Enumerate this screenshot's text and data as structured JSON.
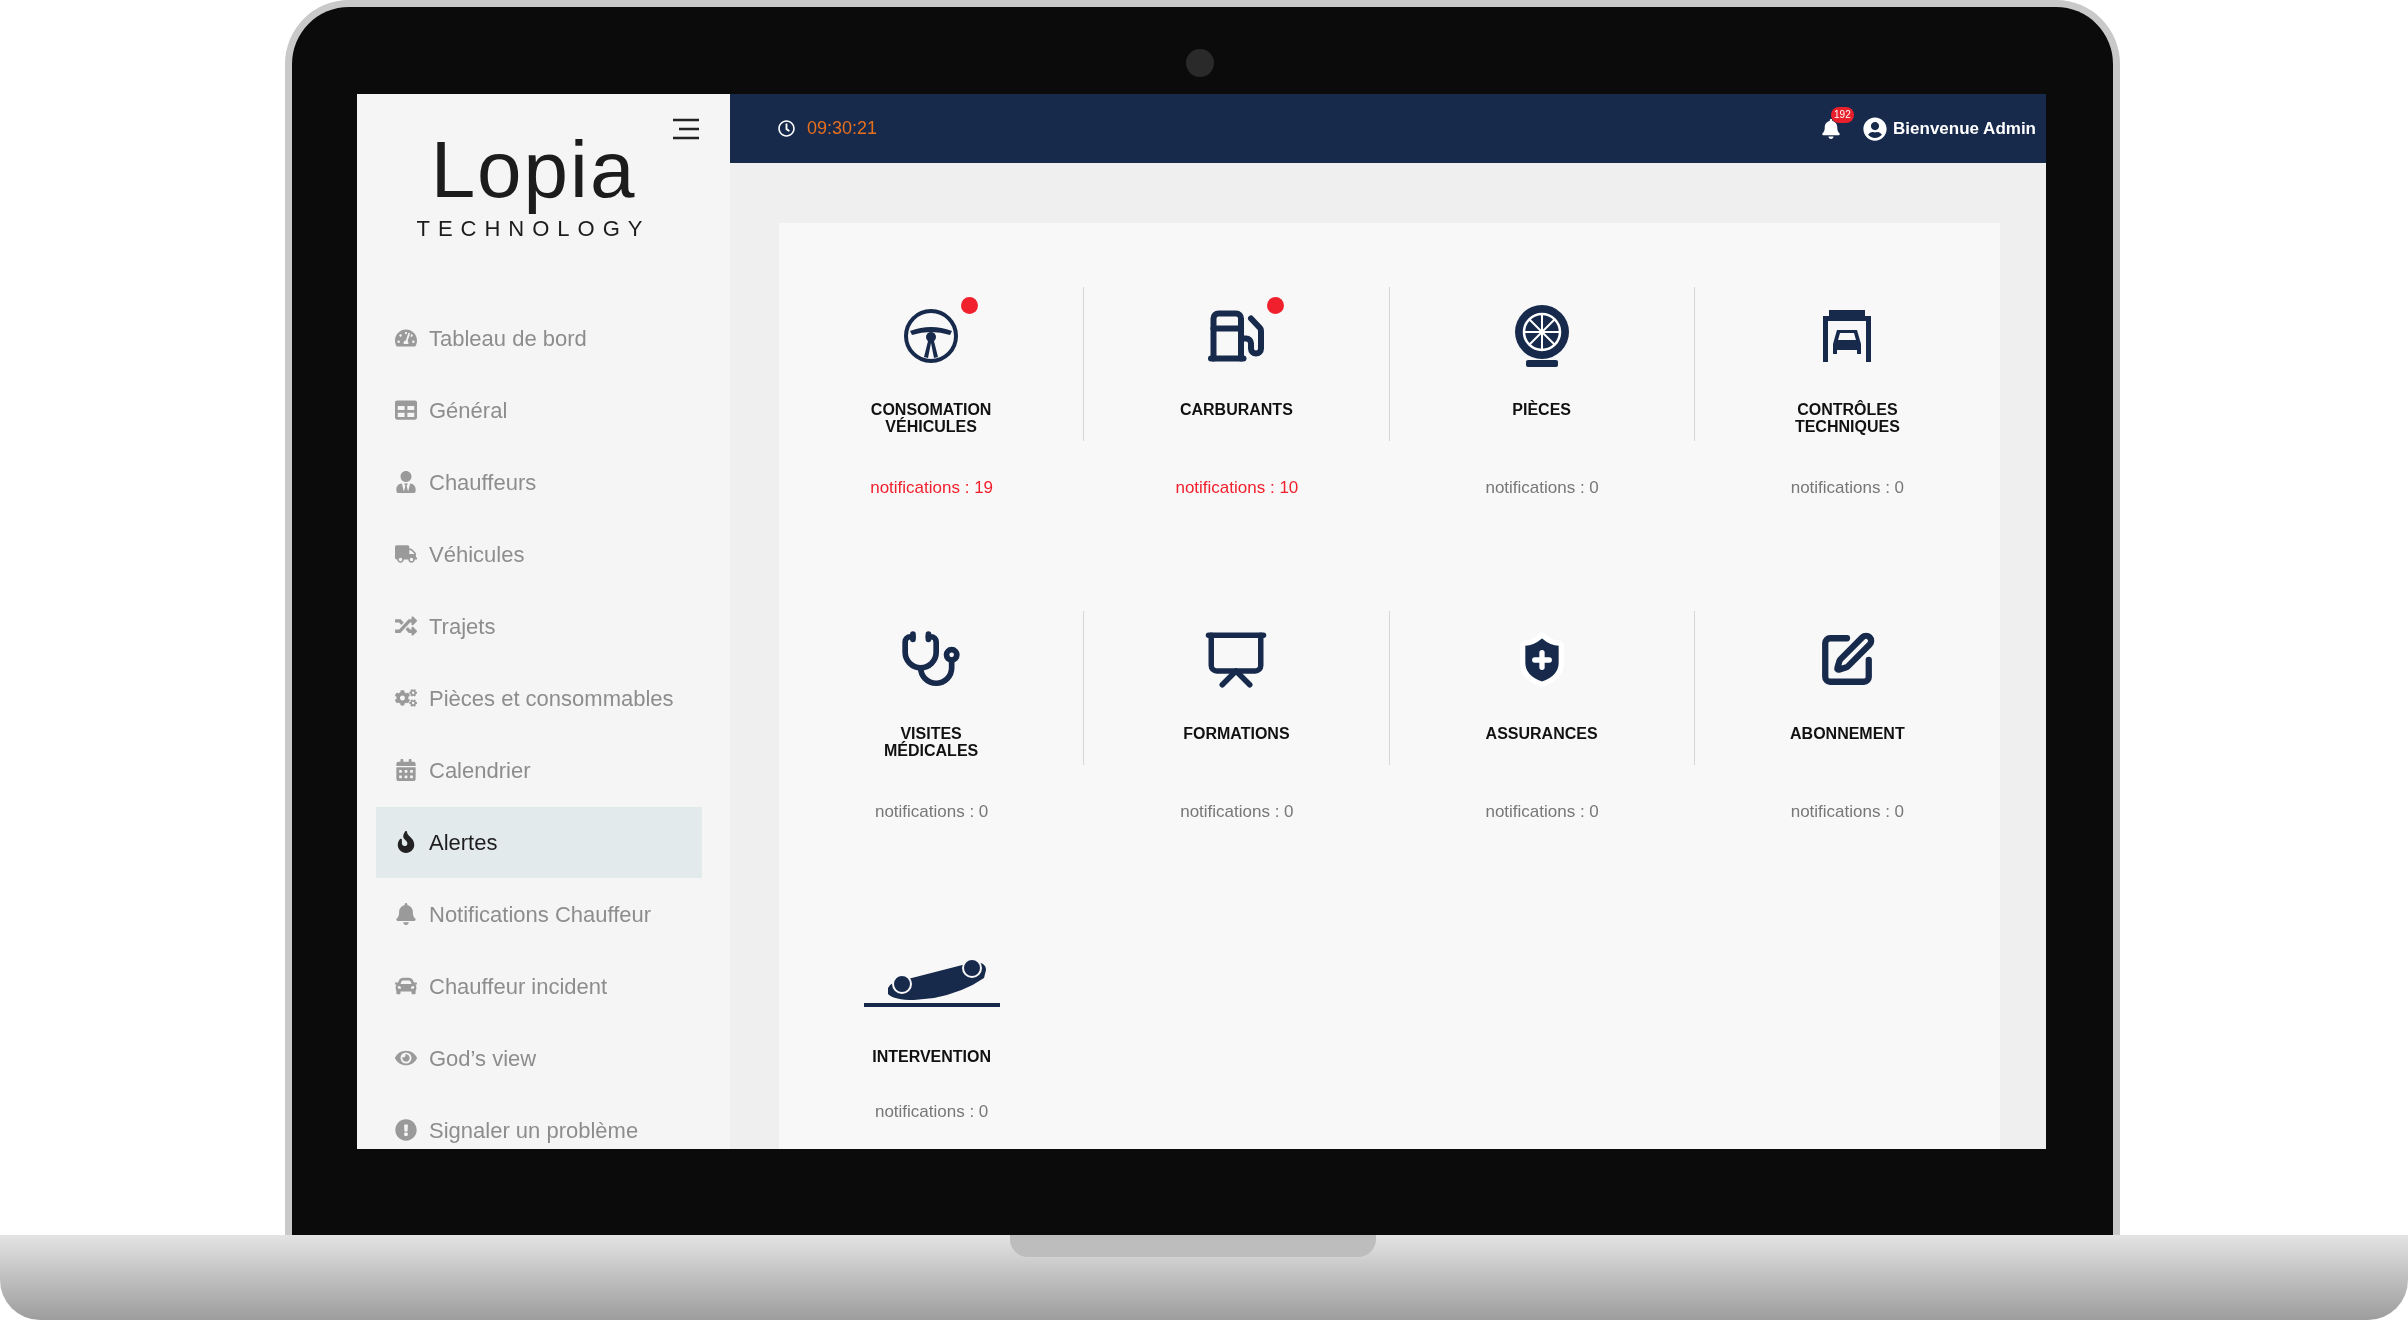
{
  "logo": {
    "name": "Lopia",
    "tagline": "TECHNOLOGY"
  },
  "sidebar": {
    "items": [
      {
        "label": "Tableau de bord",
        "kind": "gauge",
        "selected": false
      },
      {
        "label": "Général",
        "kind": "table",
        "selected": false
      },
      {
        "label": "Chauffeurs",
        "kind": "driver",
        "selected": false
      },
      {
        "label": "Véhicules",
        "kind": "truck",
        "selected": false
      },
      {
        "label": "Trajets",
        "kind": "shuffle",
        "selected": false
      },
      {
        "label": "Pièces et consommables",
        "kind": "cogs",
        "selected": false
      },
      {
        "label": "Calendrier",
        "kind": "calendar",
        "selected": false
      },
      {
        "label": "Alertes",
        "kind": "fire",
        "selected": true
      },
      {
        "label": "Notifications Chauffeur",
        "kind": "bell",
        "selected": false
      },
      {
        "label": "Chauffeur incident",
        "kind": "car",
        "selected": false
      },
      {
        "label": "God’s view",
        "kind": "eye",
        "selected": false
      },
      {
        "label": "Signaler un problème",
        "kind": "exclamation",
        "selected": false
      }
    ]
  },
  "header": {
    "time": "09:30:21",
    "notification_badge": "192",
    "greeting": "Bienvenue Admin"
  },
  "alerts": [
    {
      "kind": "steering-wheel",
      "label": "CONSOMATION VÉHICULES",
      "notifications": "notifications : 19",
      "alert": true
    },
    {
      "kind": "fuel",
      "label": "CARBURANTS",
      "notifications": "notifications : 10",
      "alert": true
    },
    {
      "kind": "tire",
      "label": "PIÈCES",
      "notifications": "notifications : 0",
      "alert": false
    },
    {
      "kind": "garage",
      "label": "CONTRÔLES TECHNIQUES",
      "notifications": "notifications : 0",
      "alert": false
    },
    {
      "kind": "stethoscope",
      "label": "VISITES MÉDICALES",
      "notifications": "notifications : 0",
      "alert": false
    },
    {
      "kind": "training",
      "label": "FORMATIONS",
      "notifications": "notifications : 0",
      "alert": false
    },
    {
      "kind": "shield",
      "label": "ASSURANCES",
      "notifications": "notifications : 0",
      "alert": false
    },
    {
      "kind": "pen",
      "label": "ABONNEMENT",
      "notifications": "notifications : 0",
      "alert": false
    },
    {
      "kind": "crash",
      "label": "INTERVENTION",
      "notifications": "notifications : 0",
      "alert": false
    }
  ]
}
